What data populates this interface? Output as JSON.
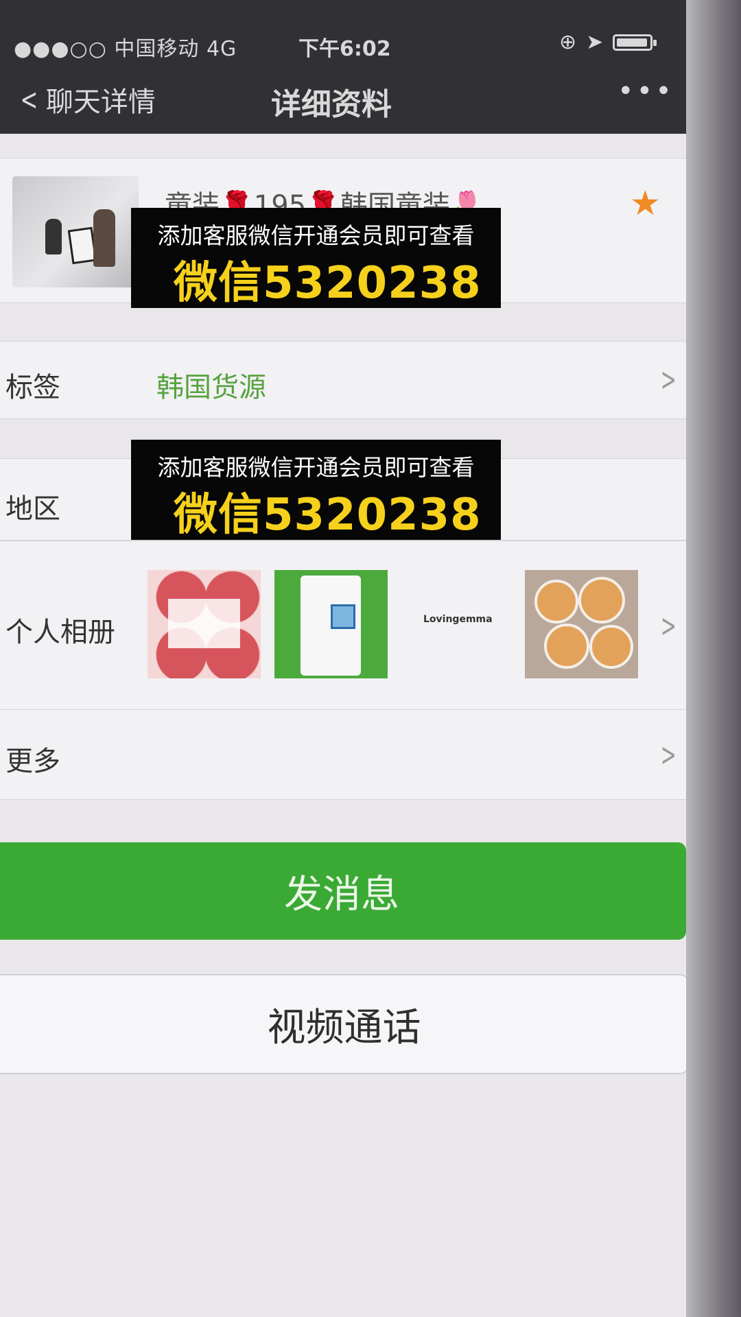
{
  "status_bar": {
    "carrier": "●●●○○ 中国移动  4G",
    "time": "下午6:02"
  },
  "nav": {
    "back_label": "聊天详情",
    "title": "详细资料",
    "more": "•••"
  },
  "profile": {
    "name": "童装🌹195🌹韩国童装🌷"
  },
  "rows": {
    "tags_label": "标签",
    "tags_value": "韩国货源",
    "region_label": "地区",
    "album_label": "个人相册",
    "album_thumb_text": "Lovingemma",
    "more_label": "更多"
  },
  "buttons": {
    "send_message": "发消息",
    "video_call": "视频通话"
  },
  "overlays": [
    {
      "line1": "添加客服微信开通会员即可查看",
      "line2": "微信5320238"
    },
    {
      "line1": "添加客服微信开通会员即可查看",
      "line2": "微信5320238"
    }
  ],
  "colors": {
    "accent_green": "#3aaa35",
    "tag_green": "#57a33f",
    "star_orange": "#f08a24",
    "overlay_yellow": "#f5d11c",
    "nav_dark": "#303035"
  },
  "icons": [
    "signal-icon",
    "back-chevron-icon",
    "more-icon",
    "star-icon",
    "chevron-right-icon",
    "battery-icon",
    "location-icon",
    "rotation-lock-icon"
  ]
}
